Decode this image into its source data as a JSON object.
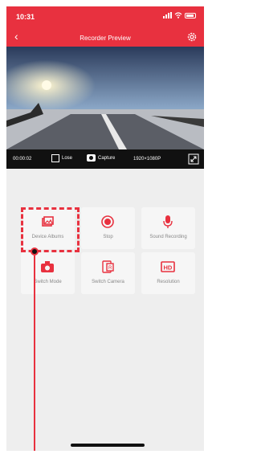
{
  "status_bar": {
    "time": "10:31"
  },
  "header": {
    "title": "Recorder Preview"
  },
  "controls": {
    "timer": "00:00:02",
    "lose_label": "Lose",
    "capture_label": "Capture",
    "resolution": "1920×1080P"
  },
  "actions": [
    {
      "label": "Device Albums",
      "icon": "album-icon"
    },
    {
      "label": "Stop",
      "icon": "stop-icon"
    },
    {
      "label": "Sound Recording",
      "icon": "microphone-icon"
    },
    {
      "label": "Switch Mode",
      "icon": "camera-icon"
    },
    {
      "label": "Switch Camera",
      "icon": "switch-camera-icon"
    },
    {
      "label": "Resolution",
      "icon": "hd-icon"
    }
  ],
  "colors": {
    "accent": "#e8313f",
    "background": "#eeeeee"
  }
}
